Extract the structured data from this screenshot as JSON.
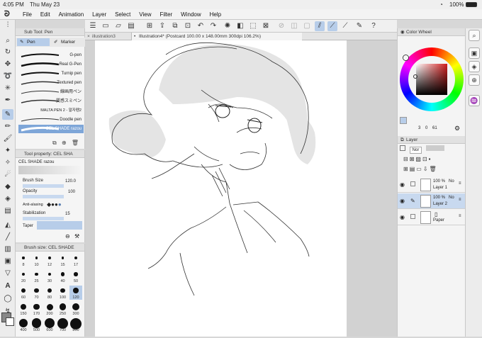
{
  "status": {
    "time": "4:05 PM",
    "date": "Thu May 23",
    "battery": "100%"
  },
  "menu": [
    "File",
    "Edit",
    "Animation",
    "Layer",
    "Select",
    "View",
    "Filter",
    "Window",
    "Help"
  ],
  "tabs": {
    "tab1": "illustration3",
    "tab2": "Illustration4* (Postcard 100.00 x 148.00mm 300dpi 106.2%)"
  },
  "subtool": {
    "title": "Sub Tool: Pen",
    "group_pen": "Pen",
    "group_marker": "Marker",
    "brushes": [
      "G-pen",
      "Real G-Pen",
      "Turnip pen",
      "Textured pen",
      "線画用ペン",
      "質感スミペン",
      "MALTA PEN 2 - 말자펜2",
      "Doodle pen",
      "CEL SHADE razou"
    ]
  },
  "toolprop": {
    "title": "Tool property: CEL SHA",
    "brush_name": "CEL SHADE razou",
    "brush_size_label": "Brush Size",
    "brush_size_value": "120.0",
    "opacity_label": "Opacity",
    "opacity_value": "100",
    "antialias_label": "Anti-alasing",
    "stabilization_label": "Stabilization",
    "stabilization_value": "15",
    "taper_label": "Taper"
  },
  "brushsize": {
    "title": "Brush size: CEL SHADE",
    "sizes": [
      "8",
      "10",
      "12",
      "15",
      "17",
      "20",
      "25",
      "30",
      "40",
      "50",
      "60",
      "70",
      "80",
      "100",
      "120",
      "150",
      "170",
      "200",
      "250",
      "300",
      "400",
      "500",
      "600",
      "700",
      "800"
    ],
    "selected": "120"
  },
  "color": {
    "title": "Color Wheel",
    "accent": "#d11d1d",
    "readout": [
      "3",
      "0",
      "61"
    ]
  },
  "layers": {
    "title": "Layer",
    "blend": "Nor",
    "opacity_field": "100",
    "items": [
      {
        "pct": "100 %",
        "mode": "No",
        "name": "Layer 1"
      },
      {
        "pct": "100 %",
        "mode": "No",
        "name": "Layer 2"
      },
      {
        "pct": "",
        "mode": "",
        "name": "Paper"
      }
    ]
  }
}
